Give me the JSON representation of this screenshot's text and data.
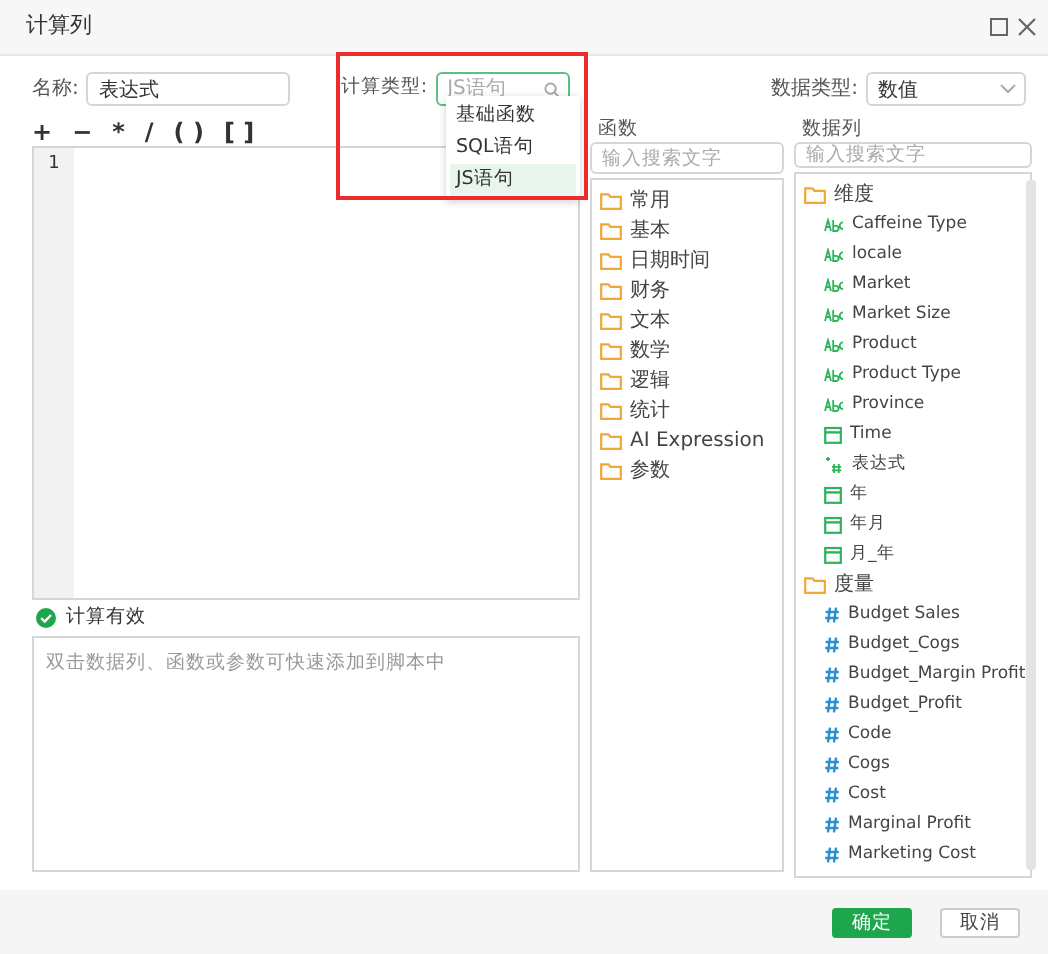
{
  "window": {
    "title": "计算列"
  },
  "form": {
    "name_label": "名称:",
    "name_value": "表达式",
    "calc_type_label": "计算类型:",
    "calc_type_placeholder": "JS语句",
    "data_type_label": "数据类型:",
    "data_type_value": "数值"
  },
  "calc_type_options": [
    {
      "label": "基础函数",
      "selected": false
    },
    {
      "label": "SQL语句",
      "selected": false
    },
    {
      "label": "JS语句",
      "selected": true
    }
  ],
  "operators": [
    "+",
    "−",
    "*",
    "/",
    "( )",
    "[ ]"
  ],
  "editor": {
    "line_numbers": [
      "1"
    ]
  },
  "functions": {
    "title": "函数",
    "search_placeholder": "输入搜索文字",
    "items": [
      "常用",
      "基本",
      "日期时间",
      "财务",
      "文本",
      "数学",
      "逻辑",
      "统计",
      "AI Expression",
      "参数"
    ]
  },
  "data_columns": {
    "title": "数据列",
    "search_placeholder": "输入搜索文字",
    "items": [
      {
        "label": "维度",
        "kind": "folder",
        "children": [
          {
            "label": "Caffeine Type",
            "kind": "text"
          },
          {
            "label": "locale",
            "kind": "text"
          },
          {
            "label": "Market",
            "kind": "text"
          },
          {
            "label": "Market Size",
            "kind": "text"
          },
          {
            "label": "Product",
            "kind": "text"
          },
          {
            "label": "Product Type",
            "kind": "text"
          },
          {
            "label": "Province",
            "kind": "text"
          },
          {
            "label": "Time",
            "kind": "date"
          },
          {
            "label": "表达式",
            "kind": "calc"
          },
          {
            "label": "年",
            "kind": "date"
          },
          {
            "label": "年月",
            "kind": "date"
          },
          {
            "label": "月_年",
            "kind": "date"
          }
        ]
      },
      {
        "label": "度量",
        "kind": "folder",
        "children": [
          {
            "label": "Budget Sales",
            "kind": "number"
          },
          {
            "label": "Budget_Cogs",
            "kind": "number"
          },
          {
            "label": "Budget_Margin Profit",
            "kind": "number"
          },
          {
            "label": "Budget_Profit",
            "kind": "number"
          },
          {
            "label": "Code",
            "kind": "number"
          },
          {
            "label": "Cogs",
            "kind": "number"
          },
          {
            "label": "Cost",
            "kind": "number"
          },
          {
            "label": "Marginal Profit",
            "kind": "number"
          },
          {
            "label": "Marketing Cost",
            "kind": "number"
          }
        ]
      }
    ]
  },
  "status": {
    "text": "计算有效",
    "valid": true
  },
  "hint": {
    "placeholder": "双击数据列、函数或参数可快速添加到脚本中"
  },
  "buttons": [
    {
      "label": "确定",
      "kind": "primary"
    },
    {
      "label": "取消",
      "kind": "secondary"
    }
  ]
}
